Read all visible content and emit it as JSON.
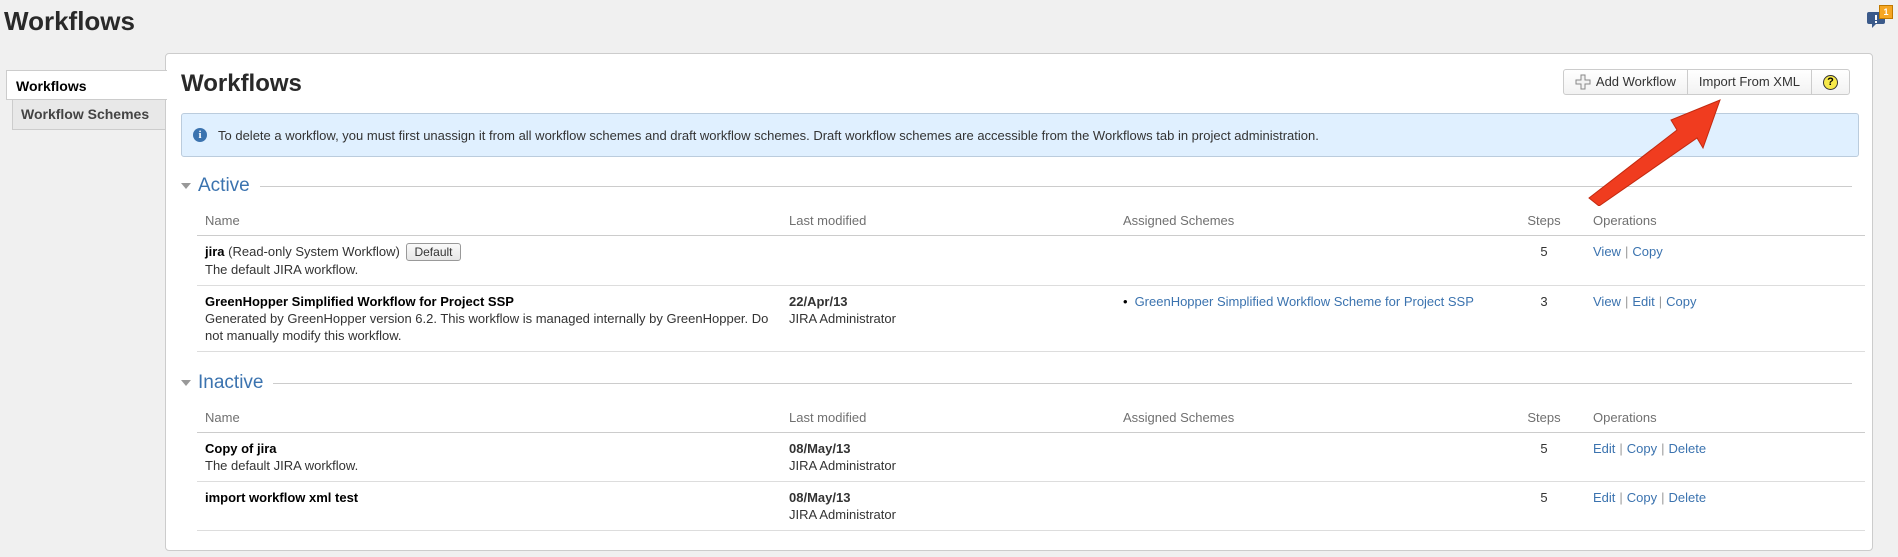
{
  "page": {
    "title": "Workflows",
    "feedback_badge": "1"
  },
  "sidebar": {
    "items": [
      {
        "label": "Workflows"
      },
      {
        "label": "Workflow Schemes"
      }
    ]
  },
  "main": {
    "title": "Workflows",
    "toolbar": {
      "add_label": "Add Workflow",
      "import_label": "Import From XML",
      "help_label": "?"
    },
    "info": "To delete a workflow, you must first unassign it from all workflow schemes and draft workflow schemes. Draft workflow schemes are accessible from the Workflows tab in project administration."
  },
  "columns": {
    "name": "Name",
    "last_modified": "Last modified",
    "assigned": "Assigned Schemes",
    "steps": "Steps",
    "operations": "Operations"
  },
  "active": {
    "label": "Active",
    "rows": [
      {
        "name": "jira",
        "name_suffix": "(Read-only System Workflow)",
        "badge": "Default",
        "description": "The default JIRA workflow.",
        "date": "",
        "user": "",
        "scheme": "",
        "steps": "5",
        "ops": [
          "View",
          "Copy"
        ]
      },
      {
        "name": "GreenHopper Simplified Workflow for Project SSP",
        "name_suffix": "",
        "badge": "",
        "description": "Generated by GreenHopper version 6.2. This workflow is managed internally by GreenHopper. Do not manually modify this workflow.",
        "date": "22/Apr/13",
        "user": "JIRA Administrator",
        "scheme": "GreenHopper Simplified Workflow Scheme for Project SSP",
        "steps": "3",
        "ops": [
          "View",
          "Edit",
          "Copy"
        ]
      }
    ]
  },
  "inactive": {
    "label": "Inactive",
    "rows": [
      {
        "name": "Copy of jira",
        "description": "The default JIRA workflow.",
        "date": "08/May/13",
        "user": "JIRA Administrator",
        "steps": "5",
        "ops": [
          "Edit",
          "Copy",
          "Delete"
        ]
      },
      {
        "name": "import workflow xml test",
        "description": "",
        "date": "08/May/13",
        "user": "JIRA Administrator",
        "steps": "5",
        "ops": [
          "Edit",
          "Copy",
          "Delete"
        ]
      }
    ]
  },
  "colors": {
    "link": "#3b73af",
    "info_bg": "#e0f0ff",
    "arrow": "#f03c1f"
  }
}
